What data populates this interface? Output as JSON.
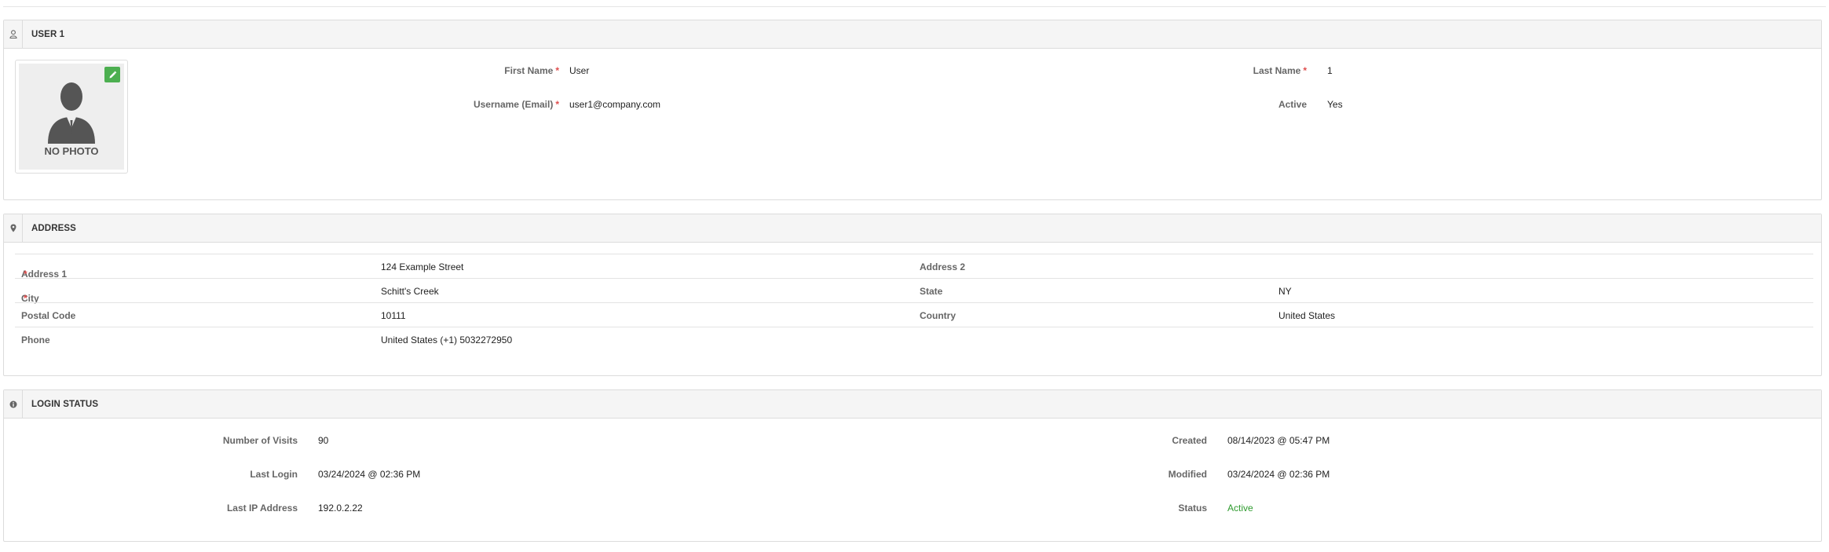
{
  "user_panel": {
    "title": "USER 1",
    "photo_label": "NO PHOTO",
    "fields": {
      "first_name": {
        "label": "First Name",
        "value": "User"
      },
      "last_name": {
        "label": "Last Name",
        "value": "1"
      },
      "username": {
        "label": "Username (Email)",
        "value": "user1@company.com"
      },
      "active": {
        "label": "Active",
        "value": "Yes"
      }
    },
    "required_mark": "*",
    "icon": "user-icon"
  },
  "address_panel": {
    "title": "ADDRESS",
    "icon": "map-marker-icon",
    "rows": [
      {
        "label1": "Address 1",
        "req1": "*",
        "value1": "124 Example Street",
        "label2": "Address 2",
        "value2": ""
      },
      {
        "label1": "City",
        "req1": "*",
        "value1": "Schitt's Creek",
        "label2": "State",
        "value2": "NY"
      },
      {
        "label1": "Postal Code",
        "req1": "",
        "value1": "10111",
        "label2": "Country",
        "value2": "United States"
      },
      {
        "label1": "Phone",
        "req1": "",
        "value1": "United States (+1) 5032272950",
        "label2": "",
        "value2": ""
      }
    ]
  },
  "login_panel": {
    "title": "LOGIN STATUS",
    "icon": "info-icon",
    "visits": {
      "label": "Number of Visits",
      "value": "90"
    },
    "last_login": {
      "label": "Last Login",
      "value": "03/24/2024 @ 02:36 PM"
    },
    "last_ip": {
      "label": "Last IP Address",
      "value": "192.0.2.22"
    },
    "created": {
      "label": "Created",
      "value": "08/14/2023 @ 05:47 PM"
    },
    "modified": {
      "label": "Modified",
      "value": "03/24/2024 @ 02:36 PM"
    },
    "status": {
      "label": "Status",
      "value": "Active"
    }
  },
  "colors": {
    "accent_green": "#4caf50",
    "required_red": "#e04e4e",
    "status_green": "#2e9b2e"
  }
}
